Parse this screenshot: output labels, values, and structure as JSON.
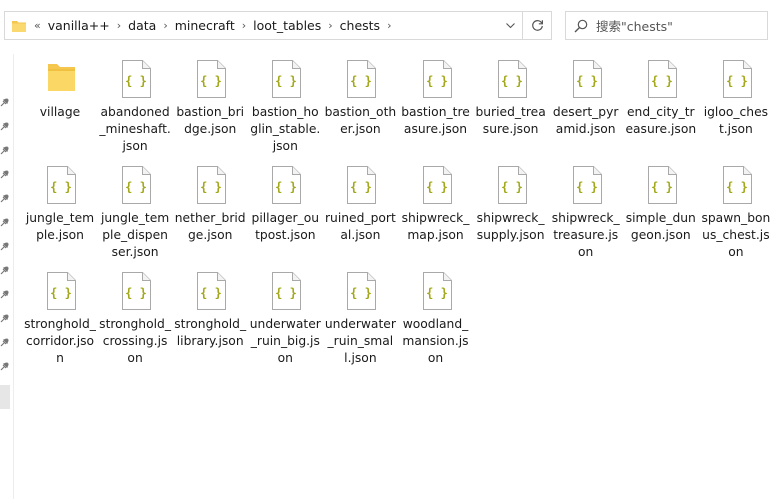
{
  "address_bar": {
    "overflow": "«",
    "breadcrumbs": [
      "vanilla++",
      "data",
      "minecraft",
      "loot_tables",
      "chests"
    ],
    "separator": "›"
  },
  "search": {
    "placeholder": "搜索\"chests\""
  },
  "files": [
    {
      "name": "village",
      "type": "folder"
    },
    {
      "name": "abandoned_mineshaft.json",
      "type": "json"
    },
    {
      "name": "bastion_bridge.json",
      "type": "json"
    },
    {
      "name": "bastion_hoglin_stable.json",
      "type": "json"
    },
    {
      "name": "bastion_other.json",
      "type": "json"
    },
    {
      "name": "bastion_treasure.json",
      "type": "json"
    },
    {
      "name": "buried_treasure.json",
      "type": "json"
    },
    {
      "name": "desert_pyramid.json",
      "type": "json"
    },
    {
      "name": "end_city_treasure.json",
      "type": "json"
    },
    {
      "name": "igloo_chest.json",
      "type": "json"
    },
    {
      "name": "jungle_temple.json",
      "type": "json"
    },
    {
      "name": "jungle_temple_dispenser.json",
      "type": "json"
    },
    {
      "name": "nether_bridge.json",
      "type": "json"
    },
    {
      "name": "pillager_outpost.json",
      "type": "json"
    },
    {
      "name": "ruined_portal.json",
      "type": "json"
    },
    {
      "name": "shipwreck_map.json",
      "type": "json"
    },
    {
      "name": "shipwreck_supply.json",
      "type": "json"
    },
    {
      "name": "shipwreck_treasure.json",
      "type": "json"
    },
    {
      "name": "simple_dungeon.json",
      "type": "json"
    },
    {
      "name": "spawn_bonus_chest.json",
      "type": "json"
    },
    {
      "name": "stronghold_corridor.json",
      "type": "json"
    },
    {
      "name": "stronghold_crossing.json",
      "type": "json"
    },
    {
      "name": "stronghold_library.json",
      "type": "json"
    },
    {
      "name": "underwater_ruin_big.json",
      "type": "json"
    },
    {
      "name": "underwater_ruin_small.json",
      "type": "json"
    },
    {
      "name": "woodland_mansion.json",
      "type": "json"
    }
  ],
  "colors": {
    "folder": "#f5c74e",
    "json_braces": "#a3a81a",
    "page_border": "#a9a9a9"
  }
}
